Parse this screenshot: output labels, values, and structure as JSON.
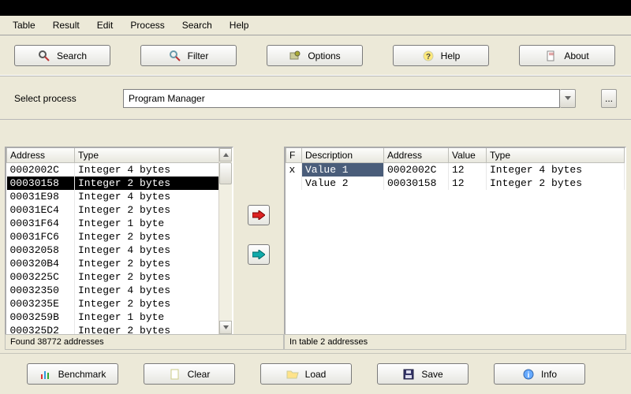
{
  "menu": {
    "items": [
      "Table",
      "Result",
      "Edit",
      "Process",
      "Search",
      "Help"
    ]
  },
  "toolbar": {
    "search": "Search",
    "filter": "Filter",
    "options": "Options",
    "help": "Help",
    "about": "About"
  },
  "process": {
    "label": "Select process",
    "value": "Program Manager"
  },
  "left": {
    "columns": [
      "Address",
      "Type"
    ],
    "rows": [
      {
        "addr": "0002002C",
        "type": "Integer 4 bytes"
      },
      {
        "addr": "00030158",
        "type": "Integer 2 bytes",
        "selected": true
      },
      {
        "addr": "00031E98",
        "type": "Integer 4 bytes"
      },
      {
        "addr": "00031EC4",
        "type": "Integer 2 bytes"
      },
      {
        "addr": "00031F64",
        "type": "Integer 1 byte"
      },
      {
        "addr": "00031FC6",
        "type": "Integer 2 bytes"
      },
      {
        "addr": "00032058",
        "type": "Integer 4 bytes"
      },
      {
        "addr": "000320B4",
        "type": "Integer 2 bytes"
      },
      {
        "addr": "0003225C",
        "type": "Integer 2 bytes"
      },
      {
        "addr": "00032350",
        "type": "Integer 4 bytes"
      },
      {
        "addr": "0003235E",
        "type": "Integer 2 bytes"
      },
      {
        "addr": "0003259B",
        "type": "Integer 1 byte"
      },
      {
        "addr": "000325D2",
        "type": "Integer 2 bytes"
      }
    ],
    "status": "Found 38772 addresses"
  },
  "right": {
    "columns": [
      "F",
      "Description",
      "Address",
      "Value",
      "Type"
    ],
    "rows": [
      {
        "f": "x",
        "desc": "Value 1",
        "addr": "0002002C",
        "val": "12",
        "type": "Integer 4 bytes",
        "highlight": true
      },
      {
        "f": "",
        "desc": "Value 2",
        "addr": "00030158",
        "val": "12",
        "type": "Integer 2 bytes"
      }
    ],
    "status": "In table 2 addresses"
  },
  "bottom": {
    "benchmark": "Benchmark",
    "clear": "Clear",
    "load": "Load",
    "save": "Save",
    "info": "Info"
  }
}
